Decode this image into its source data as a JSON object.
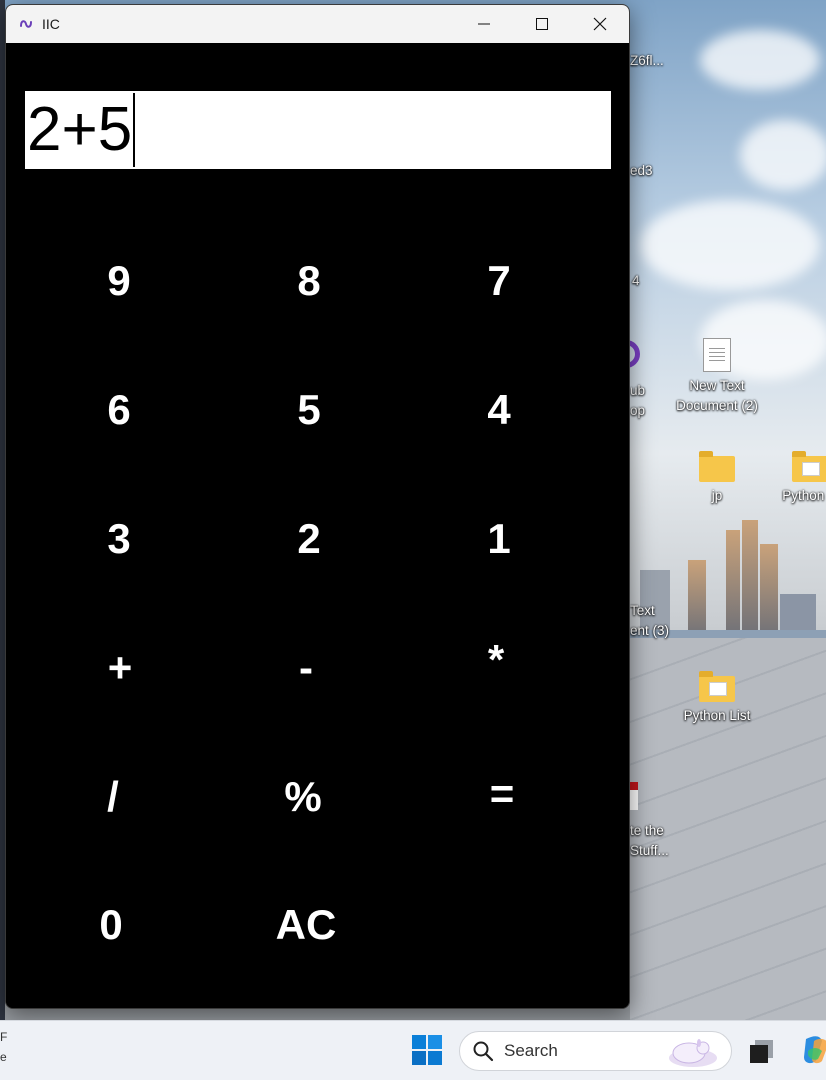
{
  "window": {
    "title": "IIC",
    "controls": {
      "minimize": "minimize",
      "maximize": "maximize",
      "close": "close"
    }
  },
  "calculator": {
    "display_value": "2+5",
    "keys": {
      "k9": "9",
      "k8": "8",
      "k7": "7",
      "k6": "6",
      "k5": "5",
      "k4": "4",
      "k3": "3",
      "k2": "2",
      "k1": "1",
      "add": "+",
      "subtract": "-",
      "multiply": "*",
      "divide": "/",
      "percent": "%",
      "equals": "=",
      "k0": "0",
      "clear": "AC"
    }
  },
  "desktop": {
    "icons": {
      "new_text_doc_2": "New Text\nDocument (2)",
      "folder_jp": "jp",
      "folder_python_r": "Python R",
      "folder_python_list": "Python List"
    },
    "partial_labels": {
      "top": "Z6fl...",
      "d3": "ed3",
      "d4": "4",
      "hub1": "ub",
      "hub2": "op",
      "text3a": "Text",
      "text3b": "ent (3)",
      "stuff1": "te the",
      "stuff2": "Stuff..."
    }
  },
  "taskbar": {
    "search_label": "Search",
    "left_edge_text": "F\ne"
  }
}
